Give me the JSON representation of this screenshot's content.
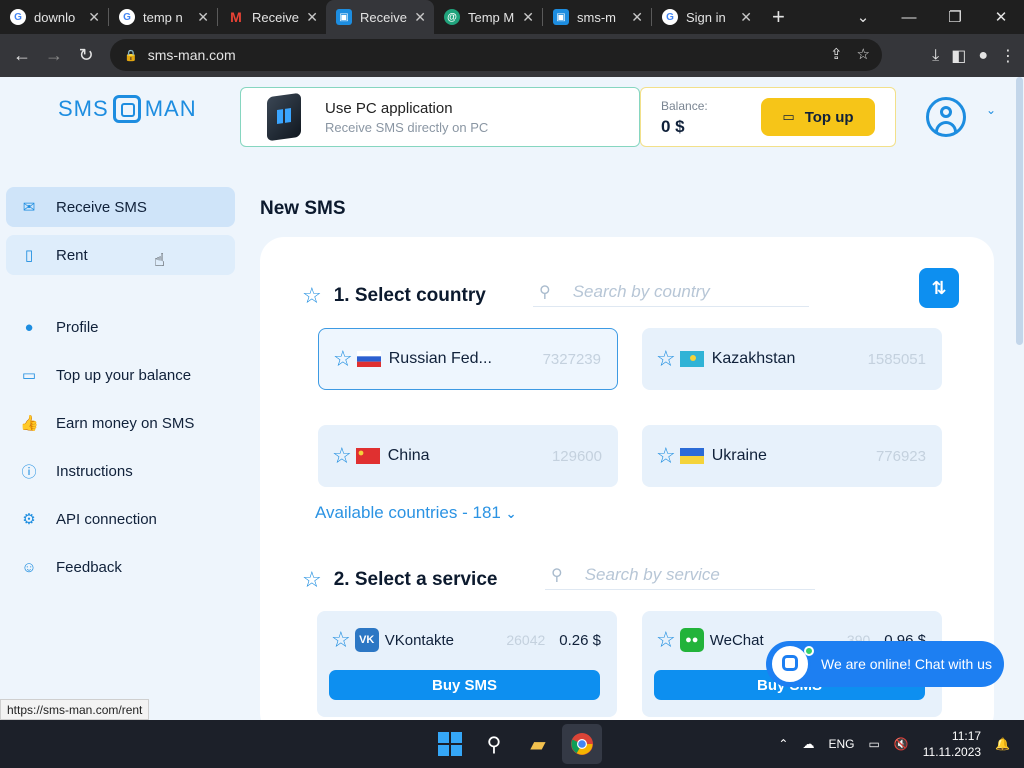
{
  "browser": {
    "tabs": [
      {
        "title": "downlo",
        "icon": "google-icon",
        "color": "#4285f4"
      },
      {
        "title": "temp n",
        "icon": "google-icon",
        "color": "#4285f4"
      },
      {
        "title": "Receive",
        "icon": "gmail-icon",
        "color": "#ea4335"
      },
      {
        "title": "Receive",
        "icon": "smsman-icon",
        "color": "#1d8de0"
      },
      {
        "title": "Temp M",
        "icon": "tempmail-icon",
        "color": "#20a37c"
      },
      {
        "title": "sms-m",
        "icon": "smsman-icon",
        "color": "#1d8de0"
      },
      {
        "title": "Sign in",
        "icon": "google-icon",
        "color": "#4285f4"
      }
    ],
    "url": "sms-man.com",
    "status_url": "https://sms-man.com/rent"
  },
  "logo": {
    "left": "SMS",
    "right": "MAN"
  },
  "sidebar": {
    "items": [
      {
        "label": "Receive SMS",
        "icon": "mail-icon"
      },
      {
        "label": "Rent",
        "icon": "phone-icon"
      },
      {
        "label": "Profile",
        "icon": "person-icon"
      },
      {
        "label": "Top up your balance",
        "icon": "card-icon"
      },
      {
        "label": "Earn money on SMS",
        "icon": "thumb-up-icon"
      },
      {
        "label": "Instructions",
        "icon": "info-icon"
      },
      {
        "label": "API connection",
        "icon": "gear-icon"
      },
      {
        "label": "Feedback",
        "icon": "feedback-icon"
      }
    ]
  },
  "banner": {
    "title": "Use PC application",
    "subtitle": "Receive SMS directly on PC"
  },
  "balance": {
    "label": "Balance:",
    "amount": "0 $",
    "topup_label": "Top up"
  },
  "main": {
    "title": "New SMS",
    "step1": {
      "title": "1. Select country",
      "search_placeholder": "Search by country"
    },
    "countries": [
      {
        "name": "Russian Fed...",
        "count": "7327239",
        "flag": "russia"
      },
      {
        "name": "Kazakhstan",
        "count": "1585051",
        "flag": "kazakhstan"
      },
      {
        "name": "China",
        "count": "129600",
        "flag": "china"
      },
      {
        "name": "Ukraine",
        "count": "776923",
        "flag": "ukraine"
      }
    ],
    "available": "Available countries - 181",
    "step2": {
      "title": "2. Select a service",
      "search_placeholder": "Search by service"
    },
    "services": [
      {
        "name": "VKontakte",
        "count": "26042",
        "price": "0.26 $",
        "buy": "Buy SMS",
        "color": "#2c77c4"
      },
      {
        "name": "WeChat",
        "count": "390",
        "price": "0.96 $",
        "buy": "Buy SMS",
        "color": "#22b33a"
      }
    ]
  },
  "chat": {
    "label": "We are online! Chat with us"
  },
  "taskbar": {
    "lang": "ENG",
    "time": "11:17",
    "date": "11.11.2023"
  },
  "colors": {
    "accent": "#1d8de0",
    "button": "#0d8ff0",
    "topup": "#f6c518"
  }
}
